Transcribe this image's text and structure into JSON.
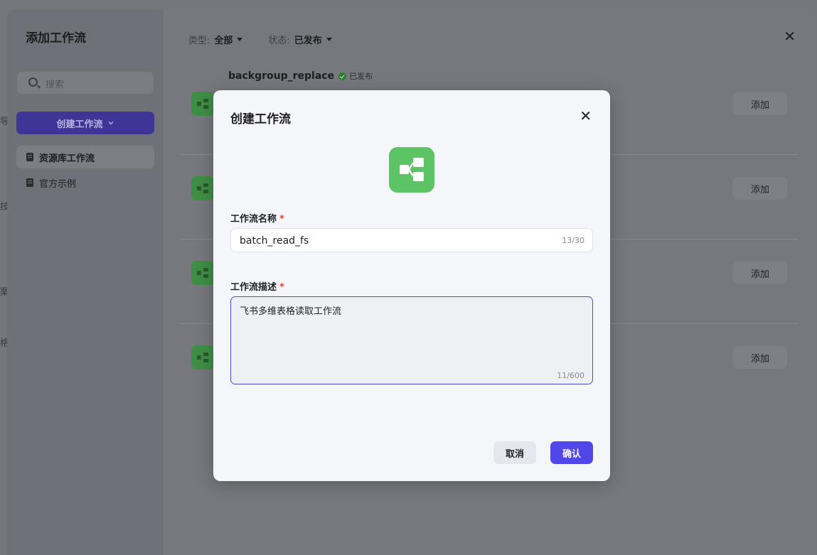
{
  "background": {
    "edge_chars": [
      "导",
      "技",
      "案",
      "格"
    ]
  },
  "panel": {
    "title": "添加工作流",
    "search_placeholder": "搜索",
    "create_button": "创建工作流",
    "side_items": [
      {
        "label": "资源库工作流",
        "active": true
      },
      {
        "label": "官方示例",
        "active": false
      }
    ],
    "filters": [
      {
        "label": "类型:",
        "value": "全部"
      },
      {
        "label": "状态:",
        "value": "已发布"
      }
    ],
    "workflows": [
      {
        "name": "backgroup_replace",
        "status": "已发布",
        "add_label": "添加"
      },
      {
        "name": "",
        "status": "",
        "add_label": "添加"
      },
      {
        "name": "",
        "status": "",
        "add_label": "添加"
      },
      {
        "name": "",
        "status": "",
        "add_label": "添加"
      }
    ]
  },
  "modal": {
    "title": "创建工作流",
    "name_label": "工作流名称",
    "name_value": "batch_read_fs",
    "name_counter": "13/30",
    "desc_label": "工作流描述",
    "desc_value": "飞书多维表格读取工作流",
    "desc_counter": "11/600",
    "required_mark": "*",
    "cancel_label": "取消",
    "confirm_label": "确认",
    "icon_color": "#5cc464",
    "accent_color": "#5147e8"
  },
  "icons": {
    "close": "close-icon",
    "workflow": "workflow-icon",
    "search": "search-icon"
  }
}
